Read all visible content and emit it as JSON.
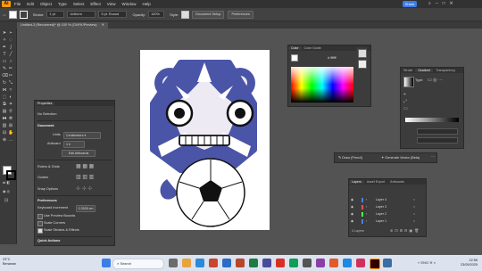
{
  "menubar": {
    "app_logo": "Ai",
    "items": [
      "File",
      "Edit",
      "Object",
      "Type",
      "Select",
      "Effect",
      "View",
      "Window",
      "Help"
    ],
    "share_label": "Share"
  },
  "control_bar": {
    "stroke_label": "Stroke:",
    "stroke_value": "1 pt",
    "uniform_label": "Uniform",
    "brush_label": "5 pt. Round",
    "opacity_label": "Opacity:",
    "opacity_value": "100%",
    "style_label": "Style:",
    "document_setup": "Document Setup",
    "preferences": "Preferences"
  },
  "document_tab": {
    "title": "Untitled-3 (Recovered)* @ 100 % (CMYK/Preview)"
  },
  "properties_panel": {
    "tab": "Properties",
    "no_selection": "No Selection",
    "document_section": "Document",
    "units_label": "Units",
    "units_value": "Centimeters",
    "artboard_label": "Artboard",
    "artboard_value": "1",
    "edit_artboards": "Edit Artboards",
    "rulers_grids": "Rulers & Grids",
    "guides": "Guides",
    "snap_options": "Snap Options",
    "preferences_section": "Preferences",
    "keyboard_increment_label": "Keyboard Increment",
    "keyboard_increment_value": "0.3528 cm",
    "use_preview_bounds": "Use Preview Bounds",
    "scale_corners": "Scale Corners",
    "scale_strokes": "Scale Strokes & Effects",
    "quick_actions": "Quick Actions"
  },
  "color_panel": {
    "tabs": [
      "Color",
      "Color Guide"
    ],
    "hex_value": "ffffff"
  },
  "gradient_panel": {
    "tabs": [
      "Stroke",
      "Gradient",
      "Transparency"
    ],
    "type_label": "Type:"
  },
  "generative_bar": {
    "draw_label": "Draw (Pencil)",
    "generate_label": "Generate Vector (Beta)"
  },
  "layers_panel": {
    "tabs": [
      "Layers",
      "Asset Export",
      "Artboards"
    ],
    "layers": [
      {
        "name": "Layer 4",
        "color": "#4f7bff"
      },
      {
        "name": "Layer 3",
        "color": "#ff4f4f"
      },
      {
        "name": "Layer 2",
        "color": "#4fff4f"
      },
      {
        "name": "Layer 1",
        "color": "#4f7bff"
      }
    ],
    "footer": "4 Layers"
  },
  "taskbar": {
    "weather_temp": "23°C",
    "weather_desc": "Berawan",
    "search_placeholder": "Search",
    "language": "ENG",
    "time": "22:56",
    "date": "23/05/2025"
  },
  "colors": {
    "accent": "#3d7de8",
    "mascot_blue": "#4a55a8",
    "mascot_light": "#eeeaf3"
  }
}
